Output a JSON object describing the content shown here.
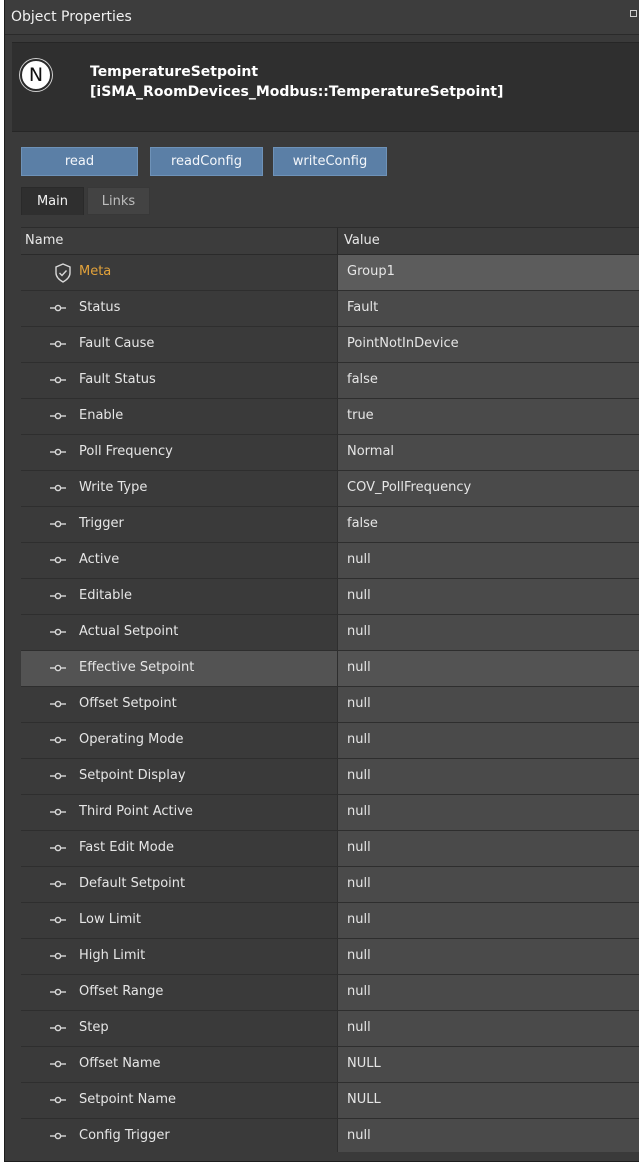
{
  "window": {
    "title": "Object Properties"
  },
  "object": {
    "icon_letter": "N",
    "name": "TemperatureSetpoint",
    "type": "[iSMA_RoomDevices_Modbus::TemperatureSetpoint]"
  },
  "actions": [
    {
      "label": "read"
    },
    {
      "label": "readConfig"
    },
    {
      "label": "writeConfig"
    }
  ],
  "tabs": [
    {
      "label": "Main",
      "active": true
    },
    {
      "label": "Links",
      "active": false
    }
  ],
  "table": {
    "columns": [
      "Name",
      "Value"
    ],
    "rows": [
      {
        "name": "Meta",
        "value": "Group1",
        "icon": "shield-icon"
      },
      {
        "name": "Status",
        "value": "Fault",
        "icon": "slot-icon"
      },
      {
        "name": "Fault Cause",
        "value": "PointNotInDevice",
        "icon": "slot-icon"
      },
      {
        "name": "Fault Status",
        "value": "false",
        "icon": "slot-icon"
      },
      {
        "name": "Enable",
        "value": "true",
        "icon": "slot-icon"
      },
      {
        "name": "Poll Frequency",
        "value": "Normal",
        "icon": "slot-icon"
      },
      {
        "name": "Write Type",
        "value": "COV_PollFrequency",
        "icon": "slot-icon"
      },
      {
        "name": "Trigger",
        "value": "false",
        "icon": "slot-icon"
      },
      {
        "name": "Active",
        "value": "null",
        "icon": "slot-icon"
      },
      {
        "name": "Editable",
        "value": "null",
        "icon": "slot-icon"
      },
      {
        "name": "Actual Setpoint",
        "value": "null",
        "icon": "slot-icon"
      },
      {
        "name": "Effective Setpoint",
        "value": "null",
        "icon": "slot-icon"
      },
      {
        "name": "Offset Setpoint",
        "value": "null",
        "icon": "slot-icon"
      },
      {
        "name": "Operating Mode",
        "value": "null",
        "icon": "slot-icon"
      },
      {
        "name": "Setpoint Display",
        "value": "null",
        "icon": "slot-icon"
      },
      {
        "name": "Third Point Active",
        "value": "null",
        "icon": "slot-icon"
      },
      {
        "name": "Fast Edit Mode",
        "value": "null",
        "icon": "slot-icon"
      },
      {
        "name": "Default Setpoint",
        "value": "null",
        "icon": "slot-icon"
      },
      {
        "name": "Low Limit",
        "value": "null",
        "icon": "slot-icon"
      },
      {
        "name": "High Limit",
        "value": "null",
        "icon": "slot-icon"
      },
      {
        "name": "Offset Range",
        "value": "null",
        "icon": "slot-icon"
      },
      {
        "name": "Step",
        "value": "null",
        "icon": "slot-icon"
      },
      {
        "name": "Offset Name",
        "value": "NULL",
        "icon": "slot-icon"
      },
      {
        "name": "Setpoint Name",
        "value": "NULL",
        "icon": "slot-icon"
      },
      {
        "name": "Config Trigger",
        "value": "null",
        "icon": "slot-icon"
      }
    ]
  },
  "colors": {
    "panel_bg": "#3a3a3a",
    "button_bg": "#5b7fa6",
    "meta_label": "#e2a23b"
  }
}
